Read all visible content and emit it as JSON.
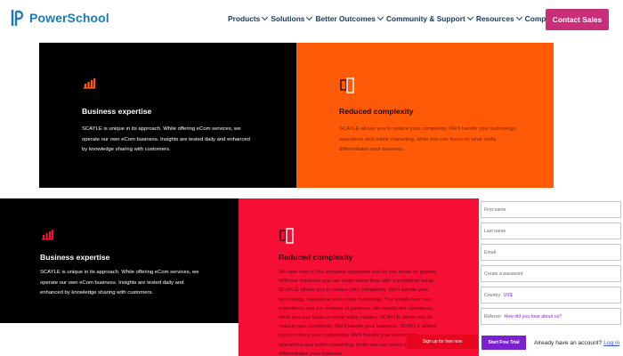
{
  "header": {
    "logo_text": "PowerSchool",
    "nav": [
      "Products",
      "Solutions",
      "Better Outcomes",
      "Community & Support",
      "Resources",
      "Company"
    ],
    "contact_label": "Contact Sales"
  },
  "panels": {
    "left_top": {
      "title": "Business expertise",
      "body": "SCAYLE is unique in its approach. While offering eCom services, we operate our own eCom business. Insights are tested daily and enhanced by knowledge sharing with customers."
    },
    "right_top": {
      "title": "Reduced complexity",
      "body": "SCAYLE allows you to reduce your complexity. We'll handle your technology, operations and online marketing, while you can focus on what really differentiates your business."
    },
    "left_bottom": {
      "title": "Business expertise",
      "body": "SCAYLE is unique in its approach. While offering eCom services, we operate our own eCom business. Insights are tested daily and enhanced by knowledge sharing with customers."
    },
    "right_bottom": {
      "title": "Reduced complexity",
      "body": "We take care of the complete operation and let you focus on growth. With our solutions you can scale faster than with a traditional setup. SCAYLE allows you to reduce your complexity. We'll handle your technology, operations and online marketing. You benefit from our experience and our network of partners. We handle the operations, while you can focus on what really matters. SCAYLE allows you to reduce your complexity. We'll handle your business. SCAYLE allows you to reduce your complexity. We'll handle your technology, operations and online marketing, while you can focus on what really differentiates your business."
    }
  },
  "form": {
    "first_name": "First name",
    "last_name": "Last name",
    "email": "Email",
    "password": "Create a password",
    "country_label": "Country:",
    "country_value": "US$",
    "referrer_label": "Referrer:",
    "referrer_value": "How did you hear about us?",
    "red_tag": "Sign up for free now",
    "start_label": "Start Free Trial",
    "already_text": "Already have an account?",
    "login_label": "Log in"
  },
  "colors": {
    "brand_blue": "#1c79b5",
    "nav_text": "#153a5b",
    "contact_bg": "#c92e78",
    "orange_panel": "#ff5a08",
    "red_panel": "#f50f34",
    "purple_button": "#7a22cf"
  },
  "icons": [
    "bar-chart-icon",
    "cube-icon"
  ]
}
